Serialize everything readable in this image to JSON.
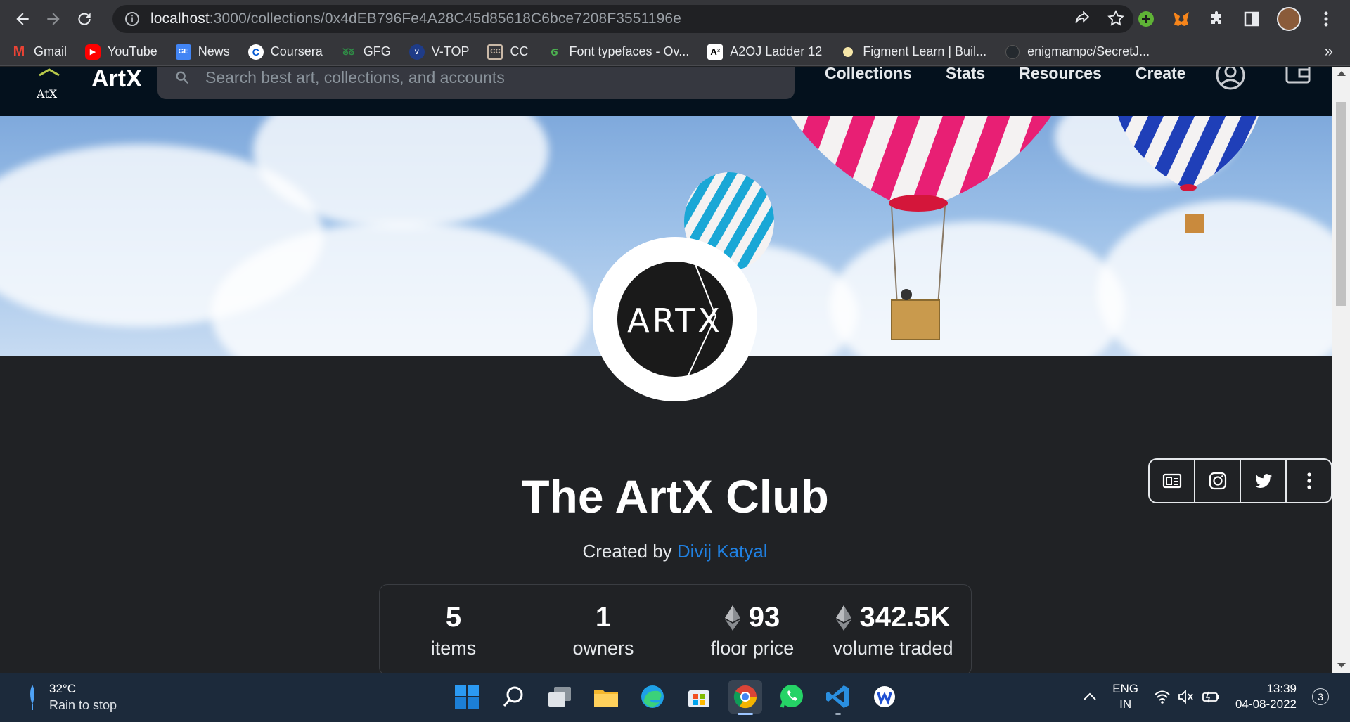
{
  "browser": {
    "url_host": "localhost",
    "url_path": ":3000/collections/0x4dEB796Fe4A28C45d85618C6bce7208F3551196e",
    "bookmarks": [
      {
        "label": "Gmail",
        "icon": "gmail-icon",
        "color": "#ea4335"
      },
      {
        "label": "YouTube",
        "icon": "youtube-icon",
        "color": "#ff0000"
      },
      {
        "label": "News",
        "icon": "google-news-icon",
        "color": "#4285f4"
      },
      {
        "label": "Coursera",
        "icon": "coursera-icon",
        "color": "#0056d2"
      },
      {
        "label": "GFG",
        "icon": "gfg-icon",
        "color": "#2f8d46"
      },
      {
        "label": "V-TOP",
        "icon": "vtop-icon",
        "color": "#1f3c88"
      },
      {
        "label": "CC",
        "icon": "codechef-icon",
        "color": "#6e4a2e"
      },
      {
        "label": "Font typefaces - Ov...",
        "icon": "leaf-icon",
        "color": "#4caf50"
      },
      {
        "label": "A2OJ Ladder 12",
        "icon": "a2oj-icon",
        "color": "#000000"
      },
      {
        "label": "Figment Learn | Buil...",
        "icon": "figment-icon",
        "color": "#f5e6a8"
      },
      {
        "label": "enigmampc/SecretJ...",
        "icon": "github-icon",
        "color": "#24292e"
      }
    ],
    "more_bookmarks": "»"
  },
  "site": {
    "brand": "ArtX",
    "search_placeholder": "Search best art, collections, and accounts",
    "nav": [
      "Collections",
      "Stats",
      "Resources",
      "Create"
    ]
  },
  "collection": {
    "title": "The ArtX Club",
    "created_by_prefix": "Created by ",
    "creator": "Divij Katyal",
    "avatar_text": "ARTX",
    "stats": [
      {
        "value": "5",
        "label": "items",
        "eth": false
      },
      {
        "value": "1",
        "label": "owners",
        "eth": false
      },
      {
        "value": "93",
        "label": "floor price",
        "eth": true
      },
      {
        "value": "342.5K",
        "label": "volume traded",
        "eth": true
      }
    ],
    "social": [
      "website-icon",
      "instagram-icon",
      "twitter-icon",
      "more-icon"
    ]
  },
  "taskbar": {
    "temperature": "32°C",
    "weather": "Rain to stop",
    "lang_line1": "ENG",
    "lang_line2": "IN",
    "time": "13:39",
    "date": "04-08-2022",
    "notifications": "3"
  },
  "colors": {
    "link": "#2081e2",
    "header_bg": "#04111d",
    "page_bg": "#202225"
  }
}
